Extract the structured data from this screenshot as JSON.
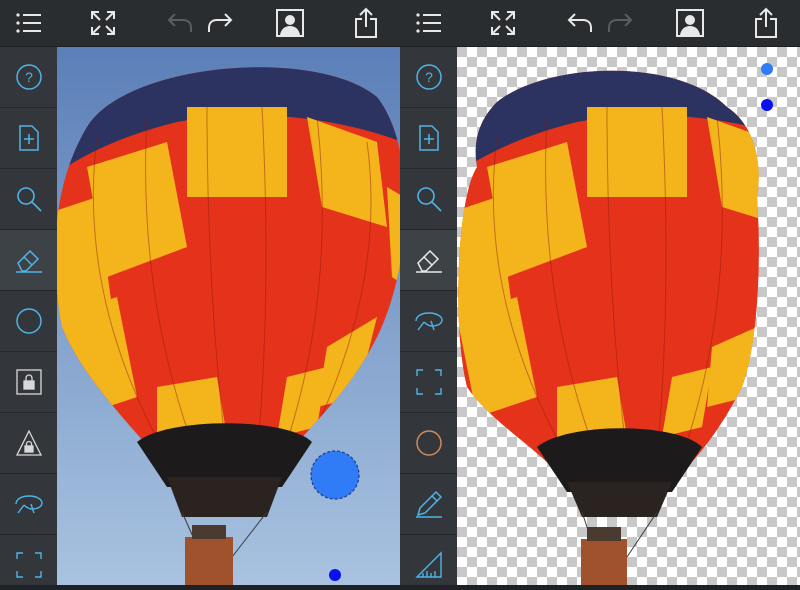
{
  "panes": [
    {
      "id": "original",
      "toolbar": [
        "menu-icon",
        "fit-screen-icon",
        "undo-icon",
        "redo-icon",
        "portrait-icon",
        "share-icon"
      ],
      "undo_enabled": false,
      "redo_enabled": true,
      "sidebar": [
        "help-icon",
        "new-document-icon",
        "zoom-icon",
        "eraser-icon",
        "circle-brush-icon",
        "lock-icon",
        "lock-triangle-icon",
        "lasso-icon",
        "crop-icon"
      ],
      "active_tool": "eraser-icon",
      "background": "photo-sky"
    },
    {
      "id": "cutout",
      "toolbar": [
        "menu-icon",
        "fit-screen-icon",
        "undo-icon",
        "redo-icon",
        "portrait-icon",
        "share-icon"
      ],
      "undo_enabled": true,
      "redo_enabled": false,
      "sidebar": [
        "help-icon",
        "new-document-icon",
        "zoom-icon",
        "eraser-icon",
        "lasso-icon",
        "crop-icon",
        "circle-brush-icon",
        "pencil-icon",
        "ruler-icon"
      ],
      "active_tool": "eraser-icon",
      "background": "transparency-checkerboard"
    }
  ],
  "colors": {
    "toolbar_bg": "#2a2d30",
    "sidebar_bg": "#33373b",
    "icon_color": "#4fb3e8",
    "sky_top": "#5b7fb8",
    "sky_bottom": "#a9c3e0",
    "brush_blue": "#2f7cf6",
    "balloon_navy": "#2d3360",
    "balloon_yellow": "#f4b41c",
    "balloon_red": "#e5331b",
    "balloon_dark": "#1c1a1a"
  }
}
